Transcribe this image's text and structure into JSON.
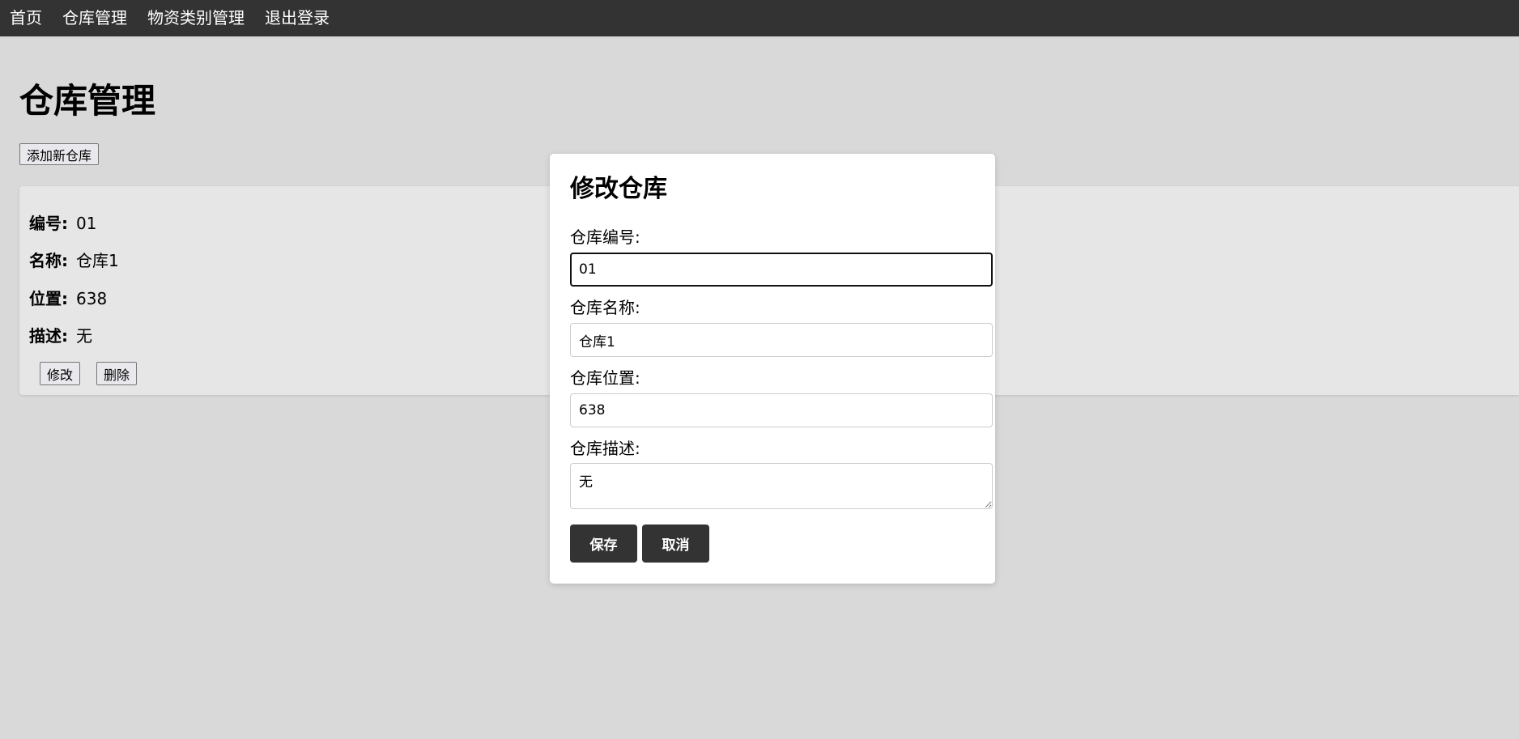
{
  "nav": {
    "items": [
      {
        "label": "首页"
      },
      {
        "label": "仓库管理"
      },
      {
        "label": "物资类别管理"
      },
      {
        "label": "退出登录"
      }
    ]
  },
  "page": {
    "title": "仓库管理",
    "add_button_label": "添加新仓库"
  },
  "warehouse_card": {
    "fields": [
      {
        "label": "编号:",
        "value": "01"
      },
      {
        "label": "名称:",
        "value": "仓库1"
      },
      {
        "label": "位置:",
        "value": "638"
      },
      {
        "label": "描述:",
        "value": "无"
      }
    ],
    "edit_label": "修改",
    "delete_label": "删除"
  },
  "modal": {
    "title": "修改仓库",
    "code_label": "仓库编号:",
    "code_value": "01",
    "name_label": "仓库名称:",
    "name_value": "仓库1",
    "location_label": "仓库位置:",
    "location_value": "638",
    "description_label": "仓库描述:",
    "description_value": "无",
    "save_label": "保存",
    "cancel_label": "取消"
  },
  "colors": {
    "navbar_bg": "#333333",
    "page_bg": "#d9d9d9",
    "card_bg": "#e6e6e6",
    "modal_bg": "#ffffff",
    "primary_button": "#333333"
  }
}
